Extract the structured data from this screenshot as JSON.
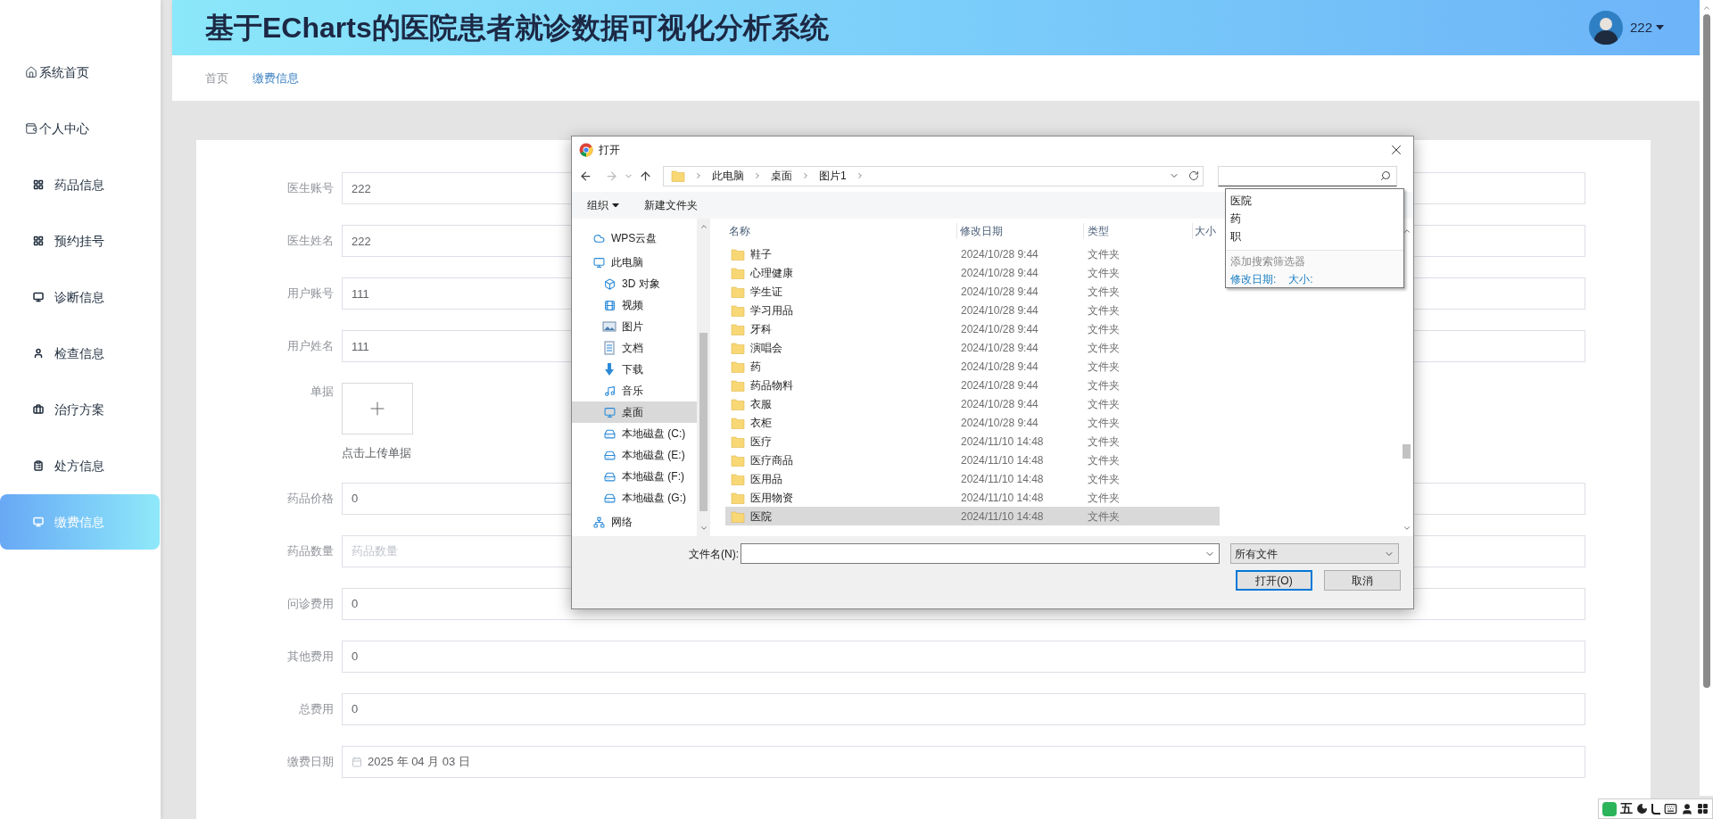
{
  "sidebar": {
    "items": [
      {
        "label": "系统首页",
        "selected": false
      },
      {
        "label": "个人中心",
        "selected": false
      },
      {
        "label": "药品信息",
        "selected": false
      },
      {
        "label": "预约挂号",
        "selected": false
      },
      {
        "label": "诊断信息",
        "selected": false
      },
      {
        "label": "检查信息",
        "selected": false
      },
      {
        "label": "治疗方案",
        "selected": false
      },
      {
        "label": "处方信息",
        "selected": false
      },
      {
        "label": "缴费信息",
        "selected": true
      }
    ]
  },
  "header": {
    "title": "基于ECharts的医院患者就诊数据可视化分析系统",
    "user": "222"
  },
  "breadcrumb": [
    {
      "label": "首页",
      "selected": false
    },
    {
      "label": "缴费信息",
      "selected": true
    }
  ],
  "form": {
    "fields": [
      {
        "kind": "text",
        "label": "医生账号",
        "value": "222"
      },
      {
        "kind": "text",
        "label": "医生姓名",
        "value": "222"
      },
      {
        "kind": "text",
        "label": "用户账号",
        "value": "111"
      },
      {
        "kind": "text",
        "label": "用户姓名",
        "value": "111"
      },
      {
        "kind": "upload",
        "label": "单据",
        "caption": "点击上传单据"
      },
      {
        "kind": "text",
        "label": "药品价格",
        "value": "0"
      },
      {
        "kind": "text",
        "label": "药品数量",
        "placeholder": "药品数量"
      },
      {
        "kind": "text",
        "label": "问诊费用",
        "value": "0"
      },
      {
        "kind": "text",
        "label": "其他费用",
        "value": "0"
      },
      {
        "kind": "text",
        "label": "总费用",
        "value": "0"
      },
      {
        "kind": "date",
        "label": "缴费日期",
        "value": "2025 年 04 月 03 日"
      }
    ]
  },
  "dialog": {
    "title": "打开",
    "path": [
      "此电脑",
      "桌面",
      "图片1"
    ],
    "toolbar": {
      "organize": "组织",
      "new_folder": "新建文件夹"
    },
    "nav": [
      {
        "label": "WPS云盘",
        "selected": false
      },
      {
        "label": "此电脑",
        "selected": false,
        "children": [
          {
            "label": "3D 对象",
            "selected": false
          },
          {
            "label": "视频",
            "selected": false
          },
          {
            "label": "图片",
            "selected": false
          },
          {
            "label": "文档",
            "selected": false
          },
          {
            "label": "下载",
            "selected": false
          },
          {
            "label": "音乐",
            "selected": false
          },
          {
            "label": "桌面",
            "selected": true
          },
          {
            "label": "本地磁盘 (C:)",
            "selected": false
          },
          {
            "label": "本地磁盘 (E:)",
            "selected": false
          },
          {
            "label": "本地磁盘 (F:)",
            "selected": false
          },
          {
            "label": "本地磁盘 (G:)",
            "selected": false
          }
        ]
      },
      {
        "label": "网络",
        "selected": false
      }
    ],
    "columns": [
      "名称",
      "修改日期",
      "类型",
      "大小"
    ],
    "rows": [
      {
        "name": "鞋子",
        "date": "2024/10/28 9:44",
        "type": "文件夹",
        "selected": false
      },
      {
        "name": "心理健康",
        "date": "2024/10/28 9:44",
        "type": "文件夹",
        "selected": false
      },
      {
        "name": "学生证",
        "date": "2024/10/28 9:44",
        "type": "文件夹",
        "selected": false
      },
      {
        "name": "学习用品",
        "date": "2024/10/28 9:44",
        "type": "文件夹",
        "selected": false
      },
      {
        "name": "牙科",
        "date": "2024/10/28 9:44",
        "type": "文件夹",
        "selected": false
      },
      {
        "name": "演唱会",
        "date": "2024/10/28 9:44",
        "type": "文件夹",
        "selected": false
      },
      {
        "name": "药",
        "date": "2024/10/28 9:44",
        "type": "文件夹",
        "selected": false
      },
      {
        "name": "药品物料",
        "date": "2024/10/28 9:44",
        "type": "文件夹",
        "selected": false
      },
      {
        "name": "衣服",
        "date": "2024/10/28 9:44",
        "type": "文件夹",
        "selected": false
      },
      {
        "name": "衣柜",
        "date": "2024/10/28 9:44",
        "type": "文件夹",
        "selected": false
      },
      {
        "name": "医疗",
        "date": "2024/11/10 14:48",
        "type": "文件夹",
        "selected": false
      },
      {
        "name": "医疗商品",
        "date": "2024/11/10 14:48",
        "type": "文件夹",
        "selected": false
      },
      {
        "name": "医用品",
        "date": "2024/11/10 14:48",
        "type": "文件夹",
        "selected": false
      },
      {
        "name": "医用物资",
        "date": "2024/11/10 14:48",
        "type": "文件夹",
        "selected": false
      },
      {
        "name": "医院",
        "date": "2024/11/10 14:48",
        "type": "文件夹",
        "selected": true
      }
    ],
    "filename_label": "文件名(N):",
    "filter": "所有文件",
    "open_button": "打开(O)",
    "cancel_button": "取消",
    "search": {
      "suggestions": [
        "医院",
        "药",
        "职"
      ],
      "filter_heading": "添加搜索筛选器",
      "filters": [
        "修改日期:",
        "大小:"
      ]
    }
  },
  "ime": {
    "mode": "五"
  }
}
